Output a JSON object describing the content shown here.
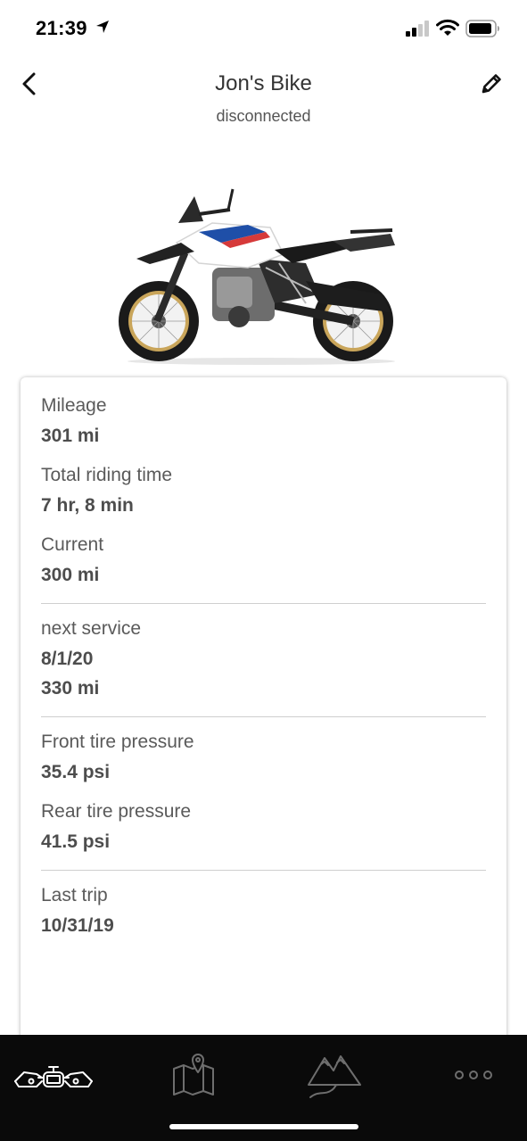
{
  "status_bar": {
    "time": "21:39"
  },
  "header": {
    "title": "Jon's Bike",
    "subtitle": "disconnected"
  },
  "stats": {
    "mileage": {
      "label": "Mileage",
      "value": "301 mi"
    },
    "riding_time": {
      "label": "Total riding time",
      "value": "7 hr, 8 min"
    },
    "current": {
      "label": "Current",
      "value": "300 mi"
    },
    "next_service": {
      "label": "next service",
      "date": "8/1/20",
      "mileage": "330 mi"
    },
    "front_tire": {
      "label": "Front tire pressure",
      "value": "35.4 psi"
    },
    "rear_tire": {
      "label": "Rear tire pressure",
      "value": "41.5 psi"
    },
    "last_trip": {
      "label": "Last trip",
      "value": "10/31/19"
    }
  },
  "tabbar": {
    "tabs": [
      {
        "icon": "motorcycle-handlebar-icon",
        "active": true
      },
      {
        "icon": "map-pin-icon",
        "active": false
      },
      {
        "icon": "mountains-route-icon",
        "active": false
      },
      {
        "icon": "more-dots-icon",
        "active": false
      }
    ]
  },
  "colors": {
    "tabbar_bg": "#0a0a0a",
    "tab_active": "#ffffff",
    "tab_inactive": "#6e6e6e"
  }
}
